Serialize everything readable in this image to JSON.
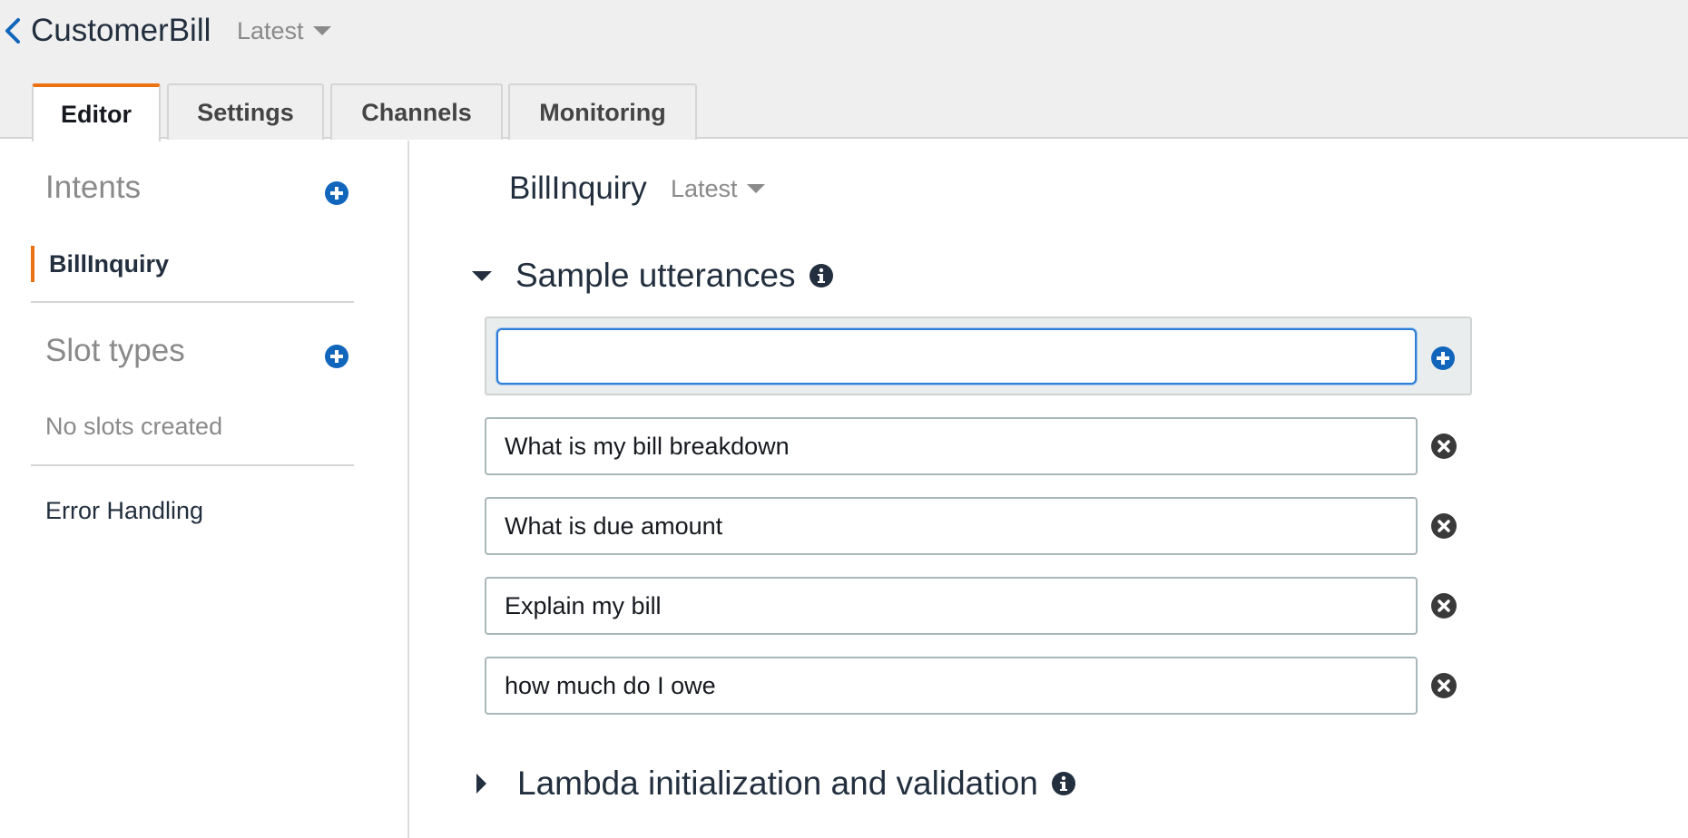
{
  "header": {
    "back_icon": "chevron-left-icon",
    "bot_name": "CustomerBill",
    "version_label": "Latest"
  },
  "tabs": [
    {
      "label": "Editor",
      "active": true
    },
    {
      "label": "Settings",
      "active": false
    },
    {
      "label": "Channels",
      "active": false
    },
    {
      "label": "Monitoring",
      "active": false
    }
  ],
  "sidebar": {
    "intents_heading": "Intents",
    "intents": [
      {
        "label": "BillInquiry",
        "selected": true
      }
    ],
    "slot_types_heading": "Slot types",
    "slot_types_empty": "No slots created",
    "error_handling_label": "Error Handling"
  },
  "intent": {
    "name": "BillInquiry",
    "version_label": "Latest"
  },
  "sample_utterances": {
    "title": "Sample utterances",
    "expanded": true,
    "new_value": "",
    "items": [
      "What is my bill breakdown",
      "What is due amount",
      "Explain my bill",
      "how much do I owe"
    ]
  },
  "lambda_section": {
    "title": "Lambda initialization and validation",
    "expanded": false
  },
  "colors": {
    "accent_orange": "#ec7211",
    "action_blue": "#1166bb",
    "focus_blue": "#2e7dd7",
    "remove_dark": "#3a3a3a"
  }
}
